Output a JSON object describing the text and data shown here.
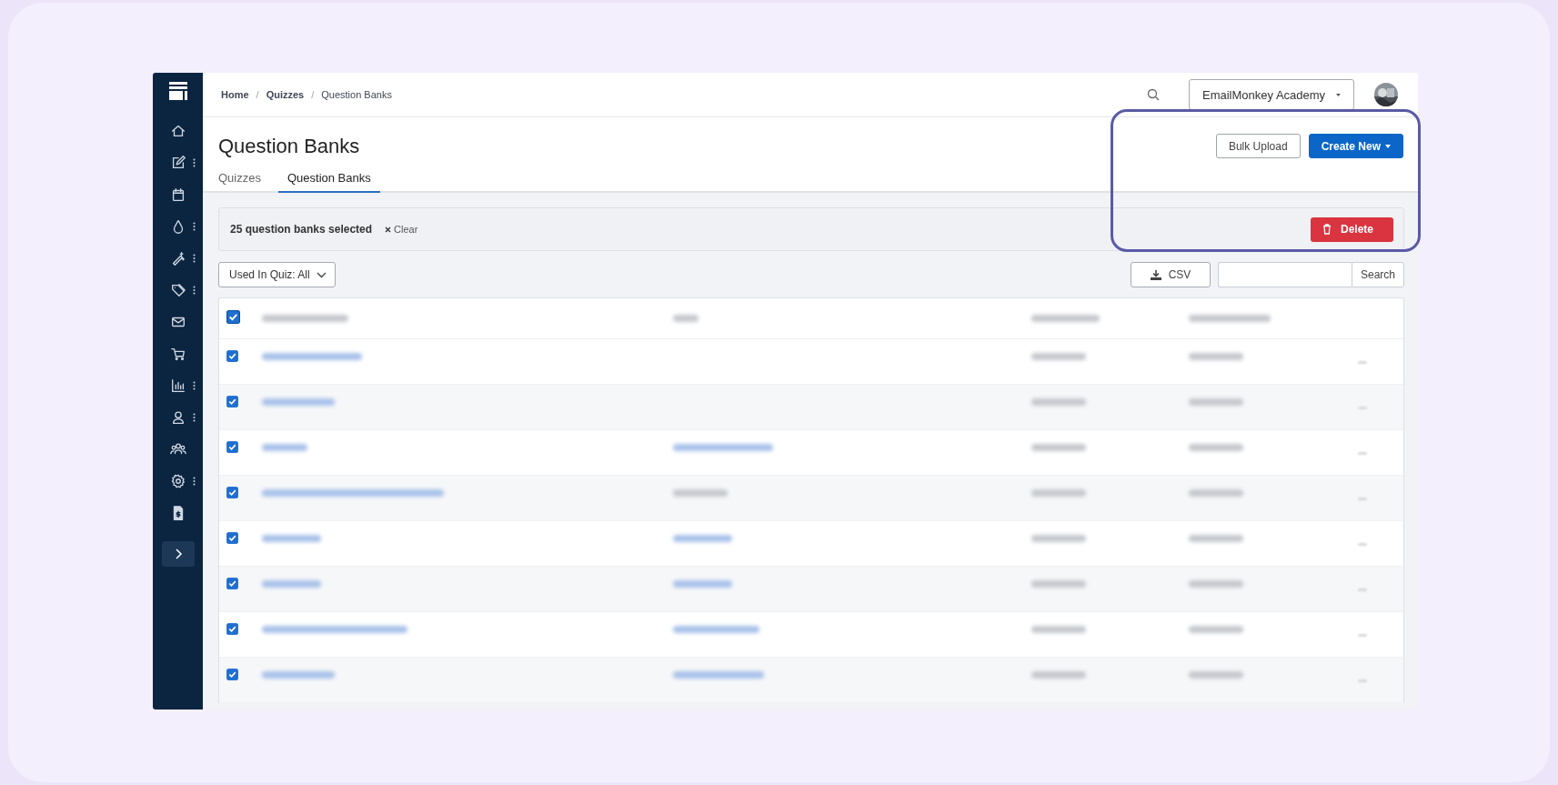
{
  "sidebar": {
    "items": [
      {
        "kind": "home",
        "more": false
      },
      {
        "kind": "edit",
        "more": true
      },
      {
        "kind": "calendar",
        "more": false
      },
      {
        "kind": "drop",
        "more": true
      },
      {
        "kind": "wand",
        "more": true
      },
      {
        "kind": "tag",
        "more": true
      },
      {
        "kind": "mail",
        "more": false
      },
      {
        "kind": "cart",
        "more": false
      },
      {
        "kind": "chart",
        "more": true
      },
      {
        "kind": "user",
        "more": true
      },
      {
        "kind": "users",
        "more": false
      },
      {
        "kind": "gear",
        "more": true
      },
      {
        "kind": "invoice",
        "more": false
      }
    ]
  },
  "breadcrumbs": [
    {
      "label": "Home",
      "current": false
    },
    {
      "label": "Quizzes",
      "current": false
    },
    {
      "label": "Question Banks",
      "current": true
    }
  ],
  "breadcrumb_separator": "/",
  "account": {
    "name": "EmailMonkey Academy"
  },
  "page": {
    "title": "Question Banks",
    "bulk_upload": "Bulk Upload",
    "create_new": "Create New"
  },
  "tabs": [
    {
      "label": "Quizzes",
      "selected": false
    },
    {
      "label": "Question Banks",
      "selected": true
    }
  ],
  "selection_bar": {
    "count": "25 question banks selected",
    "clear": "Clear",
    "delete": "Delete"
  },
  "filter": {
    "label": "Used In Quiz: All"
  },
  "csv_button": "CSV",
  "search": {
    "button": "Search"
  },
  "table": {
    "header_checked": true,
    "rows": [
      {
        "checked": true,
        "has_quiz": false
      },
      {
        "checked": true,
        "has_quiz": false
      },
      {
        "checked": true,
        "has_quiz": true
      },
      {
        "checked": true,
        "has_quiz": true
      },
      {
        "checked": true,
        "has_quiz": true
      },
      {
        "checked": true,
        "has_quiz": true
      },
      {
        "checked": true,
        "has_quiz": true
      },
      {
        "checked": true,
        "has_quiz": true
      }
    ]
  }
}
